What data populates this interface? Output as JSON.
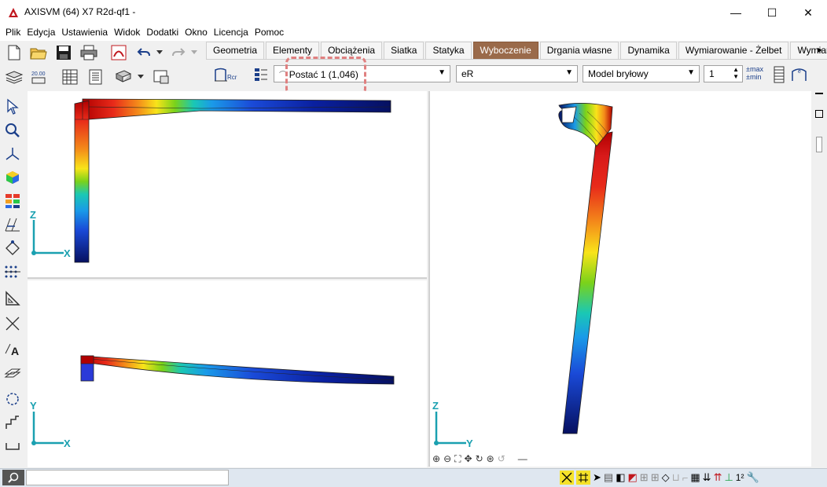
{
  "window": {
    "title": "AXISVM (64) X7 R2d-qf1 -",
    "minimize": "—",
    "maximize": "☐",
    "close": "✕"
  },
  "menu": [
    {
      "label": "Plik"
    },
    {
      "label": "Edycja"
    },
    {
      "label": "Ustawienia"
    },
    {
      "label": "Widok"
    },
    {
      "label": "Dodatki"
    },
    {
      "label": "Okno"
    },
    {
      "label": "Licencja"
    },
    {
      "label": "Pomoc"
    }
  ],
  "tabs": [
    {
      "label": "Geometria",
      "active": false
    },
    {
      "label": "Elementy",
      "active": false
    },
    {
      "label": "Obciążenia",
      "active": false
    },
    {
      "label": "Siatka",
      "active": false
    },
    {
      "label": "Statyka",
      "active": false
    },
    {
      "label": "Wyboczenie",
      "active": true
    },
    {
      "label": "Drgania własne",
      "active": false
    },
    {
      "label": "Dynamika",
      "active": false
    },
    {
      "label": "Wymiarowanie - Żelbet",
      "active": false
    },
    {
      "label": "Wymiarow",
      "active": false
    }
  ],
  "toolbar": {
    "mode_selector": "Postać 1 (1,046)",
    "component_selector": "eR",
    "display_selector": "Model bryłowy",
    "scale_value": "1",
    "max_label": "max",
    "min_label": "min",
    "tab_scroll_right": "▸"
  },
  "viewports": {
    "top_left": {
      "axis_v": "Z",
      "axis_h": "X"
    },
    "bottom_left": {
      "axis_v": "Y",
      "axis_h": "X"
    },
    "right": {
      "axis_v": "Z",
      "axis_h": "Y"
    }
  },
  "colors": {
    "active_tab": "#9a6a4a",
    "axis": "#1aa0b0",
    "highlight": "#e08080"
  }
}
